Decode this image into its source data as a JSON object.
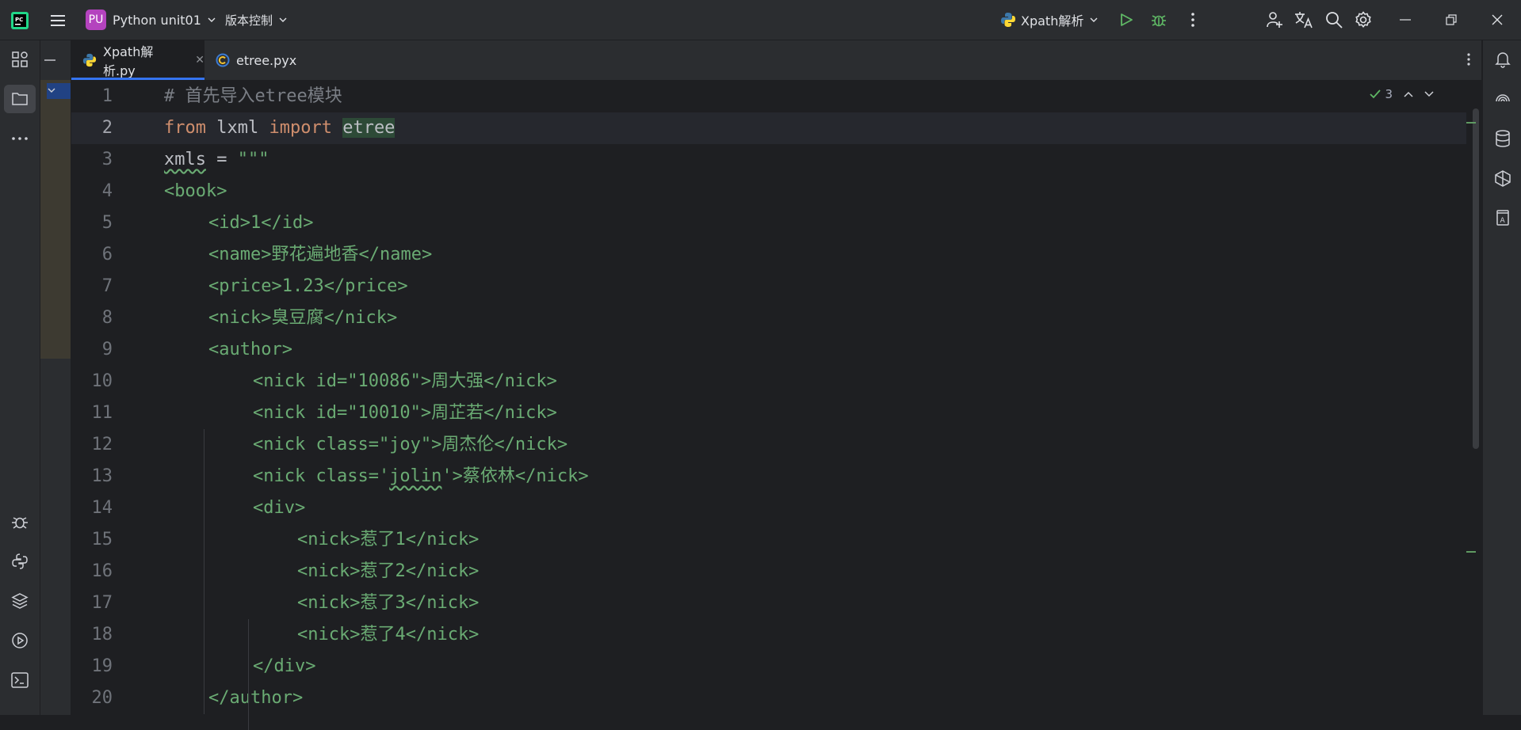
{
  "titlebar": {
    "project_badge": "PU",
    "project_name": "Python unit01",
    "vcs_label": "版本控制",
    "run_config": "Xpath解析"
  },
  "tabs": [
    {
      "label": "Xpath解析.py",
      "active": true,
      "icon": "python-file-icon"
    },
    {
      "label": "etree.pyx",
      "active": false,
      "icon": "cython-file-icon"
    }
  ],
  "inspections": {
    "ok_count": "3"
  },
  "editor": {
    "current_line": 2,
    "lines": [
      {
        "num": "1",
        "indent": 0,
        "tokens": [
          {
            "t": "# 首先导入etree模块",
            "c": "cm"
          }
        ]
      },
      {
        "num": "2",
        "indent": 0,
        "tokens": [
          {
            "t": "from",
            "c": "kw"
          },
          {
            "t": " lxml ",
            "c": ""
          },
          {
            "t": "import",
            "c": "kw"
          },
          {
            "t": " ",
            "c": ""
          },
          {
            "t": "etree",
            "c": "hl"
          }
        ]
      },
      {
        "num": "3",
        "indent": 0,
        "tokens": [
          {
            "t": "xmls",
            "c": "warn"
          },
          {
            "t": " = ",
            "c": ""
          },
          {
            "t": "\"\"\"",
            "c": "str"
          }
        ]
      },
      {
        "num": "4",
        "indent": 0,
        "tokens": [
          {
            "t": "<book>",
            "c": "str"
          }
        ]
      },
      {
        "num": "5",
        "indent": 1,
        "tokens": [
          {
            "t": "<id>1</id>",
            "c": "str"
          }
        ]
      },
      {
        "num": "6",
        "indent": 1,
        "tokens": [
          {
            "t": "<name>野花遍地香</name>",
            "c": "str"
          }
        ]
      },
      {
        "num": "7",
        "indent": 1,
        "tokens": [
          {
            "t": "<price>1.23</price>",
            "c": "str"
          }
        ]
      },
      {
        "num": "8",
        "indent": 1,
        "tokens": [
          {
            "t": "<nick>臭豆腐</nick>",
            "c": "str"
          }
        ]
      },
      {
        "num": "9",
        "indent": 1,
        "tokens": [
          {
            "t": "<author>",
            "c": "str"
          }
        ]
      },
      {
        "num": "10",
        "indent": 2,
        "tokens": [
          {
            "t": "<nick id=\"10086\">周大强</nick>",
            "c": "str"
          }
        ]
      },
      {
        "num": "11",
        "indent": 2,
        "tokens": [
          {
            "t": "<nick id=\"10010\">周芷若</nick>",
            "c": "str"
          }
        ]
      },
      {
        "num": "12",
        "indent": 2,
        "tokens": [
          {
            "t": "<nick class=\"joy\">周杰伦</nick>",
            "c": "str"
          }
        ]
      },
      {
        "num": "13",
        "indent": 2,
        "tokens": [
          {
            "t": "<nick class='",
            "c": "str"
          },
          {
            "t": "jolin",
            "c": "strwarn"
          },
          {
            "t": "'>蔡依林</nick>",
            "c": "str"
          }
        ]
      },
      {
        "num": "14",
        "indent": 2,
        "tokens": [
          {
            "t": "<div>",
            "c": "str"
          }
        ]
      },
      {
        "num": "15",
        "indent": 3,
        "tokens": [
          {
            "t": "<nick>惹了1</nick>",
            "c": "str"
          }
        ]
      },
      {
        "num": "16",
        "indent": 3,
        "tokens": [
          {
            "t": "<nick>惹了2</nick>",
            "c": "str"
          }
        ]
      },
      {
        "num": "17",
        "indent": 3,
        "tokens": [
          {
            "t": "<nick>惹了3</nick>",
            "c": "str"
          }
        ]
      },
      {
        "num": "18",
        "indent": 3,
        "tokens": [
          {
            "t": "<nick>惹了4</nick>",
            "c": "str"
          }
        ]
      },
      {
        "num": "19",
        "indent": 2,
        "tokens": [
          {
            "t": "</div>",
            "c": "str"
          }
        ]
      },
      {
        "num": "20",
        "indent": 1,
        "tokens": [
          {
            "t": "</author>",
            "c": "str"
          }
        ]
      }
    ]
  },
  "colors": {
    "keyword": "#cf8e6d",
    "string": "#6aab73",
    "comment": "#7a7e85",
    "accent": "#3574f0",
    "project_badge": "#b443be",
    "run_green": "#5fb865"
  }
}
